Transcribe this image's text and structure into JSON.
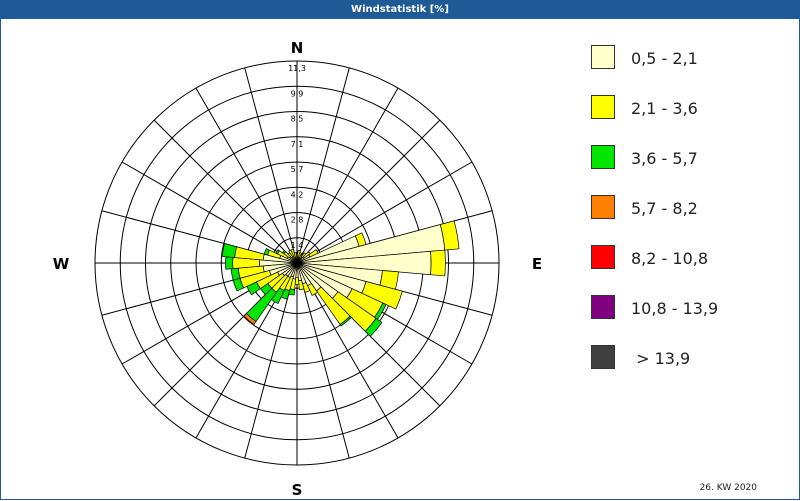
{
  "window": {
    "title": "Windstatistik [%]"
  },
  "footer": {
    "text": "26. KW 2020"
  },
  "legend": [
    {
      "label": "0,5 - 2,1",
      "color": "#ffffcc"
    },
    {
      "label": "2,1 - 3,6",
      "color": "#ffff00"
    },
    {
      "label": "3,6 - 5,7",
      "color": "#00e600"
    },
    {
      "label": "5,7 - 8,2",
      "color": "#ff8000"
    },
    {
      "label": "8,2 - 10,8",
      "color": "#ff0000"
    },
    {
      "label": "10,8 - 13,9",
      "color": "#800080"
    },
    {
      "label": " > 13,9",
      "color": "#404040"
    }
  ],
  "chart_data": {
    "type": "windrose",
    "title": "Windstatistik [%]",
    "unit": "%",
    "directions_count": 36,
    "ring_labels": [
      "1,4",
      "2,8",
      "4,2",
      "5,7",
      "7,1",
      "8,5",
      "9,9",
      "11,3"
    ],
    "rmax": 11.3,
    "cardinal_labels": {
      "N": "N",
      "E": "E",
      "S": "S",
      "W": "W"
    },
    "speed_bins": [
      "0,5 - 2,1",
      "2,1 - 3,6",
      "3,6 - 5,7",
      "5,7 - 8,2",
      "8,2 - 10,8",
      "10,8 - 13,9",
      "> 13,9"
    ],
    "sectors": [
      {
        "direction": 0,
        "values": [
          0.2,
          0.3,
          0,
          0,
          0,
          0,
          0
        ]
      },
      {
        "direction": 10,
        "values": [
          0.3,
          0.4,
          0,
          0,
          0,
          0,
          0
        ]
      },
      {
        "direction": 20,
        "values": [
          0.3,
          0.3,
          0,
          0,
          0,
          0,
          0
        ]
      },
      {
        "direction": 30,
        "values": [
          0.3,
          0.2,
          0,
          0,
          0,
          0,
          0
        ]
      },
      {
        "direction": 40,
        "values": [
          0.4,
          0.3,
          0,
          0,
          0,
          0,
          0
        ]
      },
      {
        "direction": 50,
        "values": [
          0.5,
          0.4,
          0,
          0,
          0,
          0,
          0
        ]
      },
      {
        "direction": 60,
        "values": [
          0.8,
          0.5,
          0,
          0,
          0,
          0,
          0
        ]
      },
      {
        "direction": 70,
        "values": [
          3.6,
          0.4,
          0,
          0,
          0,
          0,
          0
        ]
      },
      {
        "direction": 80,
        "values": [
          8.3,
          0.8,
          0,
          0,
          0,
          0,
          0
        ]
      },
      {
        "direction": 90,
        "values": [
          7.5,
          0.8,
          0,
          0,
          0,
          0,
          0
        ]
      },
      {
        "direction": 100,
        "values": [
          4.8,
          0.9,
          0,
          0,
          0,
          0,
          0
        ]
      },
      {
        "direction": 110,
        "values": [
          4.0,
          2.1,
          0,
          0,
          0,
          0,
          0
        ]
      },
      {
        "direction": 120,
        "values": [
          3.4,
          1.9,
          0.2,
          0,
          0,
          0,
          0
        ]
      },
      {
        "direction": 130,
        "values": [
          2.8,
          2.6,
          0.4,
          0,
          0,
          0,
          0
        ]
      },
      {
        "direction": 140,
        "values": [
          1.9,
          2.3,
          0.1,
          0,
          0,
          0,
          0
        ]
      },
      {
        "direction": 150,
        "values": [
          1.4,
          0.6,
          0,
          0,
          0,
          0,
          0
        ]
      },
      {
        "direction": 160,
        "values": [
          1.2,
          0.5,
          0,
          0,
          0,
          0,
          0
        ]
      },
      {
        "direction": 170,
        "values": [
          1.0,
          0.5,
          0,
          0,
          0,
          0,
          0
        ]
      },
      {
        "direction": 180,
        "values": [
          0.8,
          0.4,
          0,
          0,
          0,
          0,
          0
        ]
      },
      {
        "direction": 190,
        "values": [
          0.9,
          0.6,
          0.3,
          0,
          0,
          0,
          0
        ]
      },
      {
        "direction": 200,
        "values": [
          0.8,
          0.8,
          0.5,
          0,
          0,
          0,
          0
        ]
      },
      {
        "direction": 210,
        "values": [
          0.9,
          0.8,
          0.8,
          0,
          0,
          0,
          0
        ]
      },
      {
        "direction": 220,
        "values": [
          0.9,
          1.1,
          2.0,
          0.2,
          0,
          0,
          0
        ]
      },
      {
        "direction": 230,
        "values": [
          1.0,
          1.0,
          0.5,
          0,
          0,
          0,
          0
        ]
      },
      {
        "direction": 240,
        "values": [
          1.2,
          1.3,
          0.6,
          0,
          0,
          0,
          0
        ]
      },
      {
        "direction": 250,
        "values": [
          1.6,
          1.7,
          0.4,
          0,
          0,
          0,
          0
        ]
      },
      {
        "direction": 260,
        "values": [
          1.9,
          1.4,
          0.4,
          0,
          0,
          0,
          0
        ]
      },
      {
        "direction": 270,
        "values": [
          2.1,
          1.5,
          0.4,
          0,
          0,
          0,
          0
        ]
      },
      {
        "direction": 280,
        "values": [
          1.9,
          1.6,
          0.7,
          0,
          0,
          0,
          0
        ]
      },
      {
        "direction": 290,
        "values": [
          1.0,
          0.7,
          0.2,
          0,
          0,
          0,
          0
        ]
      },
      {
        "direction": 300,
        "values": [
          0.6,
          0.6,
          0.1,
          0,
          0,
          0,
          0
        ]
      },
      {
        "direction": 310,
        "values": [
          0.5,
          0.4,
          0.1,
          0,
          0,
          0,
          0
        ]
      },
      {
        "direction": 320,
        "values": [
          0.4,
          0.3,
          0,
          0,
          0,
          0,
          0
        ]
      },
      {
        "direction": 330,
        "values": [
          0.4,
          0.4,
          0,
          0,
          0,
          0,
          0
        ]
      },
      {
        "direction": 340,
        "values": [
          0.3,
          0.5,
          0,
          0,
          0,
          0,
          0
        ]
      },
      {
        "direction": 350,
        "values": [
          0.2,
          0.4,
          0,
          0,
          0,
          0,
          0
        ]
      }
    ]
  }
}
